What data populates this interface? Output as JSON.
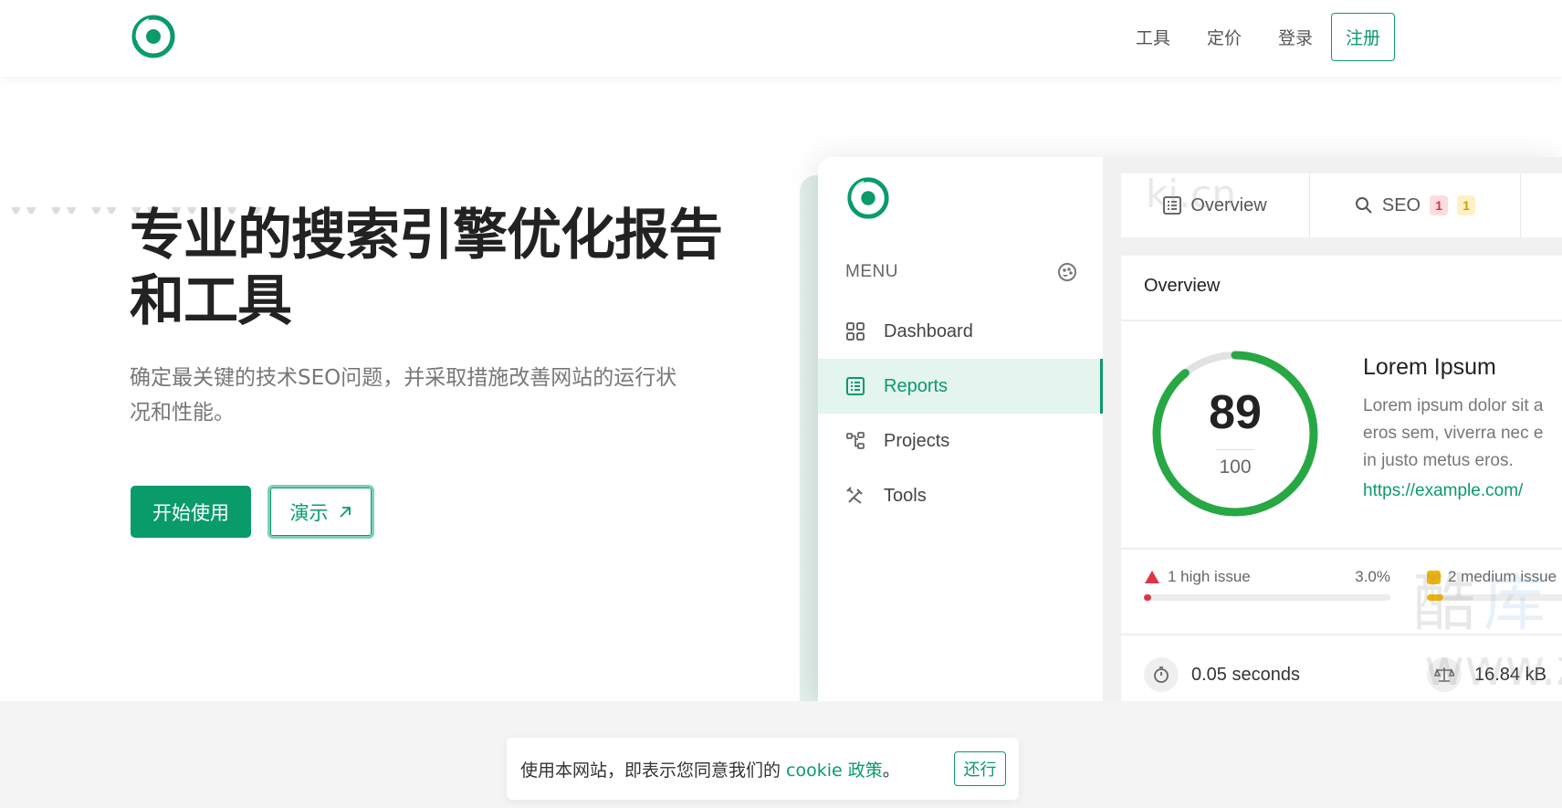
{
  "header": {
    "logo": "brand-logo",
    "nav": [
      {
        "label": "工具"
      },
      {
        "label": "定价"
      },
      {
        "label": "登录"
      }
    ],
    "signup_label": "注册"
  },
  "hero": {
    "title_line1": "专业的搜索引擎优化报告",
    "title_line2": "和工具",
    "subtitle_line1": "确定最关键的技术SEO问题，并采取措施改善网站的运行状",
    "subtitle_line2": "况和性能。",
    "start_button": "开始使用",
    "demo_button": "演示",
    "demo_icon": "arrow-up-right-icon"
  },
  "app": {
    "menu_label": "MENU",
    "sidebar": [
      {
        "label": "Dashboard",
        "icon": "grid-icon",
        "active": false
      },
      {
        "label": "Reports",
        "icon": "list-icon",
        "active": true
      },
      {
        "label": "Projects",
        "icon": "tree-icon",
        "active": false
      },
      {
        "label": "Tools",
        "icon": "tools-icon",
        "active": false
      }
    ],
    "tabs": [
      {
        "label": "Overview",
        "icon": "list-icon"
      },
      {
        "label": "SEO",
        "icon": "search-icon",
        "badges": [
          "1",
          "1"
        ]
      }
    ],
    "card": {
      "title": "Overview",
      "score": "89",
      "score_max": "100",
      "score_fraction": 0.89,
      "site_title": "Lorem Ipsum",
      "site_desc": [
        "Lorem ipsum dolor sit a",
        "eros sem, viverra nec e",
        "in justo metus eros."
      ],
      "site_url": "https://example.com/",
      "issues": [
        {
          "label": "1 high issue",
          "percent": "3.0%",
          "fraction": 0.03,
          "color": "#dc3545"
        },
        {
          "label": "2 medium issue",
          "percent": "",
          "fraction": 0.06,
          "color": "#f0b400"
        }
      ],
      "stats": [
        {
          "label": "0.05 seconds",
          "icon": "stopwatch-icon"
        },
        {
          "label": "16.84 kB",
          "icon": "scale-icon"
        }
      ]
    }
  },
  "cookie": {
    "text": "使用本网站，即表示您同意我们的 ",
    "link": "cookie 政策",
    "suffix": "。",
    "button": "还行"
  },
  "colors": {
    "brand": "#0a9b6a",
    "score_ring": "#28a745",
    "high": "#dc3545",
    "medium": "#f0b400"
  }
}
